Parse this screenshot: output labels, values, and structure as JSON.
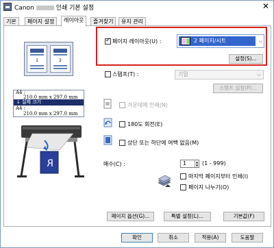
{
  "window": {
    "title_prefix": "Canon",
    "title_suffix": "인쇄 기본 설정",
    "close_glyph": "✕"
  },
  "tabs": [
    {
      "label": "기본"
    },
    {
      "label": "페이지 설정"
    },
    {
      "label": "레이아웃"
    },
    {
      "label": "즐겨찾기"
    },
    {
      "label": "유지 관리"
    }
  ],
  "preview": {
    "pages": [
      "1",
      "2"
    ]
  },
  "size_info": {
    "source_label": "A4 :",
    "source_size": "210.0 mm x 297.0 mm",
    "mode": "↓ 실제 크기",
    "output_label": "A4 :",
    "output_size": "210.0 mm x 297.0 mm"
  },
  "page_layout": {
    "checked": true,
    "label": "페이지 레이아웃(U) :",
    "value": "2 페이지/시트",
    "settings_button": "설정(S)..."
  },
  "stamp": {
    "checked": false,
    "label": "스탬프(T) :",
    "value": "기밀",
    "settings_button": "스탬프 설정(P)..."
  },
  "center_print": {
    "checked": false,
    "label": "가운데에 인쇄(N)"
  },
  "rotate_180": {
    "checked": false,
    "label": "180도 회전(E)"
  },
  "no_margin": {
    "checked": false,
    "label": "상단 또는 하단에 여백 없음(M)"
  },
  "copies": {
    "label": "매수(C) :",
    "value": "1",
    "range": "(1 - 999)",
    "last_page_first": {
      "checked": false,
      "label": "마지막 페이지부터 인쇄(I)"
    },
    "collate": {
      "checked": false,
      "label": "페이지 나누기(O)"
    }
  },
  "bottom_buttons": {
    "page_options": "페이지 옵션(G)...",
    "special_settings": "특별 설정(L)...",
    "defaults": "기본값(F)"
  },
  "dialog_buttons": {
    "ok": "확인",
    "cancel": "취소",
    "apply": "적용(A)",
    "help": "도움말"
  },
  "colors": {
    "accent_red": "#d6201c",
    "selection_blue": "#3366cc",
    "dark_navy": "#1d2e6a"
  }
}
